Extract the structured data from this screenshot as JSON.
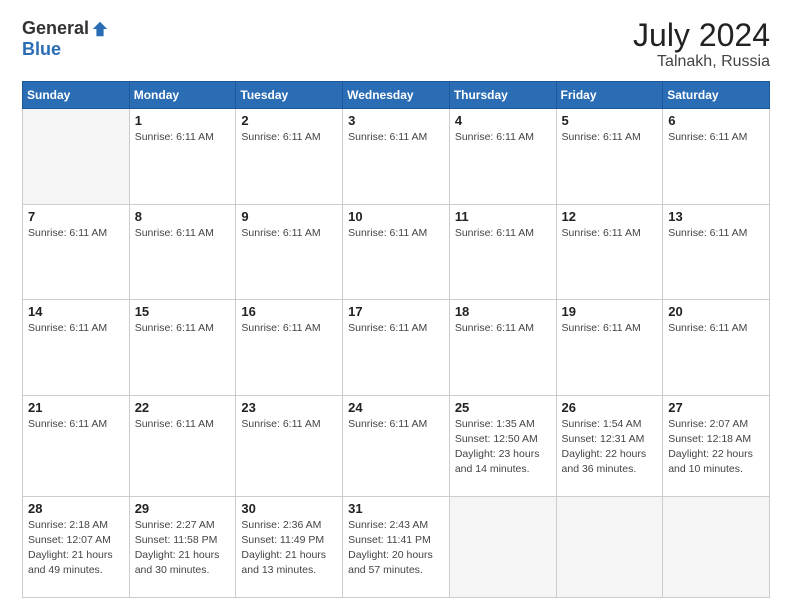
{
  "header": {
    "logo_general": "General",
    "logo_blue": "Blue",
    "month_year": "July 2024",
    "location": "Talnakh, Russia"
  },
  "weekdays": [
    "Sunday",
    "Monday",
    "Tuesday",
    "Wednesday",
    "Thursday",
    "Friday",
    "Saturday"
  ],
  "weeks": [
    [
      {
        "num": "",
        "info": ""
      },
      {
        "num": "1",
        "info": "Sunrise: 6:11 AM"
      },
      {
        "num": "2",
        "info": "Sunrise: 6:11 AM"
      },
      {
        "num": "3",
        "info": "Sunrise: 6:11 AM"
      },
      {
        "num": "4",
        "info": "Sunrise: 6:11 AM"
      },
      {
        "num": "5",
        "info": "Sunrise: 6:11 AM"
      },
      {
        "num": "6",
        "info": "Sunrise: 6:11 AM"
      }
    ],
    [
      {
        "num": "7",
        "info": "Sunrise: 6:11 AM"
      },
      {
        "num": "8",
        "info": "Sunrise: 6:11 AM"
      },
      {
        "num": "9",
        "info": "Sunrise: 6:11 AM"
      },
      {
        "num": "10",
        "info": "Sunrise: 6:11 AM"
      },
      {
        "num": "11",
        "info": "Sunrise: 6:11 AM"
      },
      {
        "num": "12",
        "info": "Sunrise: 6:11 AM"
      },
      {
        "num": "13",
        "info": "Sunrise: 6:11 AM"
      }
    ],
    [
      {
        "num": "14",
        "info": "Sunrise: 6:11 AM"
      },
      {
        "num": "15",
        "info": "Sunrise: 6:11 AM"
      },
      {
        "num": "16",
        "info": "Sunrise: 6:11 AM"
      },
      {
        "num": "17",
        "info": "Sunrise: 6:11 AM"
      },
      {
        "num": "18",
        "info": "Sunrise: 6:11 AM"
      },
      {
        "num": "19",
        "info": "Sunrise: 6:11 AM"
      },
      {
        "num": "20",
        "info": "Sunrise: 6:11 AM"
      }
    ],
    [
      {
        "num": "21",
        "info": "Sunrise: 6:11 AM"
      },
      {
        "num": "22",
        "info": "Sunrise: 6:11 AM"
      },
      {
        "num": "23",
        "info": "Sunrise: 6:11 AM"
      },
      {
        "num": "24",
        "info": "Sunrise: 6:11 AM"
      },
      {
        "num": "25",
        "info": "Sunrise: 1:35 AM\nSunset: 12:50 AM\nDaylight: 23 hours and 14 minutes."
      },
      {
        "num": "26",
        "info": "Sunrise: 1:54 AM\nSunset: 12:31 AM\nDaylight: 22 hours and 36 minutes."
      },
      {
        "num": "27",
        "info": "Sunrise: 2:07 AM\nSunset: 12:18 AM\nDaylight: 22 hours and 10 minutes."
      }
    ],
    [
      {
        "num": "28",
        "info": "Sunrise: 2:18 AM\nSunset: 12:07 AM\nDaylight: 21 hours and 49 minutes."
      },
      {
        "num": "29",
        "info": "Sunrise: 2:27 AM\nSunset: 11:58 PM\nDaylight: 21 hours and 30 minutes."
      },
      {
        "num": "30",
        "info": "Sunrise: 2:36 AM\nSunset: 11:49 PM\nDaylight: 21 hours and 13 minutes."
      },
      {
        "num": "31",
        "info": "Sunrise: 2:43 AM\nSunset: 11:41 PM\nDaylight: 20 hours and 57 minutes."
      },
      {
        "num": "",
        "info": ""
      },
      {
        "num": "",
        "info": ""
      },
      {
        "num": "",
        "info": ""
      }
    ]
  ]
}
